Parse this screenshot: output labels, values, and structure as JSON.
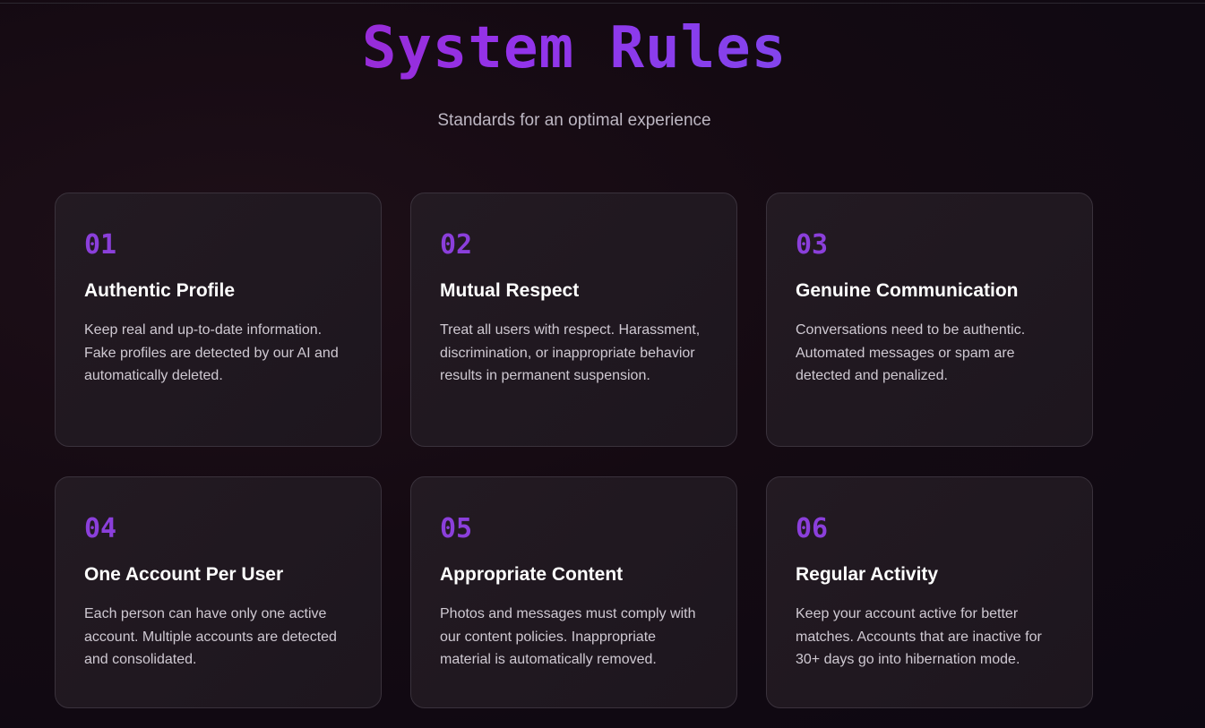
{
  "header": {
    "title": "System Rules",
    "subtitle": "Standards for an optimal experience"
  },
  "rules": [
    {
      "number": "01",
      "title": "Authentic Profile",
      "description": "Keep real and up-to-date information. Fake profiles are detected by our AI and automatically deleted."
    },
    {
      "number": "02",
      "title": "Mutual Respect",
      "description": "Treat all users with respect. Harassment, discrimination, or inappropriate behavior results in permanent suspension."
    },
    {
      "number": "03",
      "title": "Genuine Communication",
      "description": "Conversations need to be authentic. Automated messages or spam are detected and penalized."
    },
    {
      "number": "04",
      "title": "One Account Per User",
      "description": "Each person can have only one active account. Multiple accounts are detected and consolidated."
    },
    {
      "number": "05",
      "title": "Appropriate Content",
      "description": "Photos and messages must comply with our content policies. Inappropriate material is automatically removed."
    },
    {
      "number": "06",
      "title": "Regular Activity",
      "description": "Keep your account active for better matches. Accounts that are inactive for 30+ days go into hibernation mode."
    }
  ],
  "colors": {
    "background": "#140a12",
    "accent_number": "#8b3fdb",
    "title_gradient_start": "#a21caf",
    "title_gradient_end": "#6d5bf0",
    "card_border": "#3a323c"
  }
}
